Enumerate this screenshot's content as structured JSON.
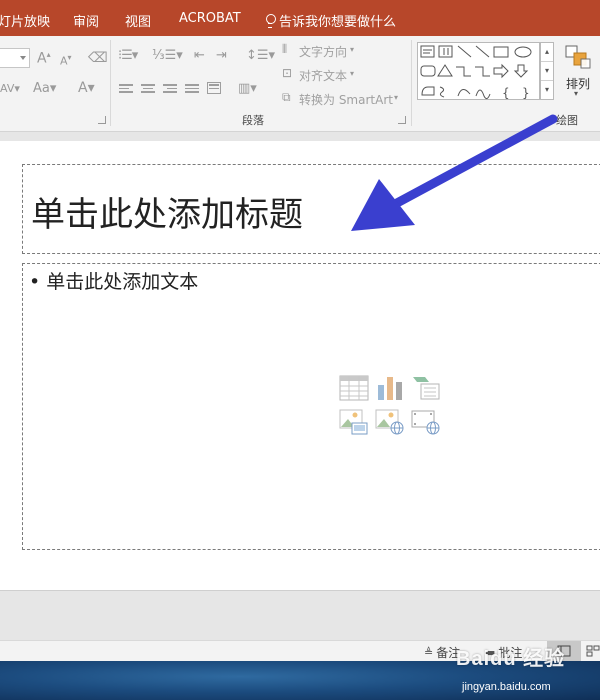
{
  "tabs": [
    {
      "label": "灯片放映"
    },
    {
      "label": "审阅"
    },
    {
      "label": "视图"
    },
    {
      "label": "ACROBAT"
    },
    {
      "label": "告诉我你想要做什么"
    }
  ],
  "ribbon": {
    "text_direction": "文字方向",
    "align_text": "对齐文本",
    "convert_smartart": "转换为 SmartArt",
    "paragraph_label": "段落",
    "drawing_label": "绘图",
    "arrange_label": "排列"
  },
  "slide": {
    "title_placeholder": "单击此处添加标题",
    "body_placeholder": "• 单击此处添加文本"
  },
  "status": {
    "notes": "备注",
    "comments": "批注"
  },
  "watermark": {
    "logo": "Baidu 经验",
    "url": "jingyan.baidu.com"
  },
  "colors": {
    "ribbon_tab_bg": "#b7472a",
    "arrow": "#3a3fcf"
  }
}
